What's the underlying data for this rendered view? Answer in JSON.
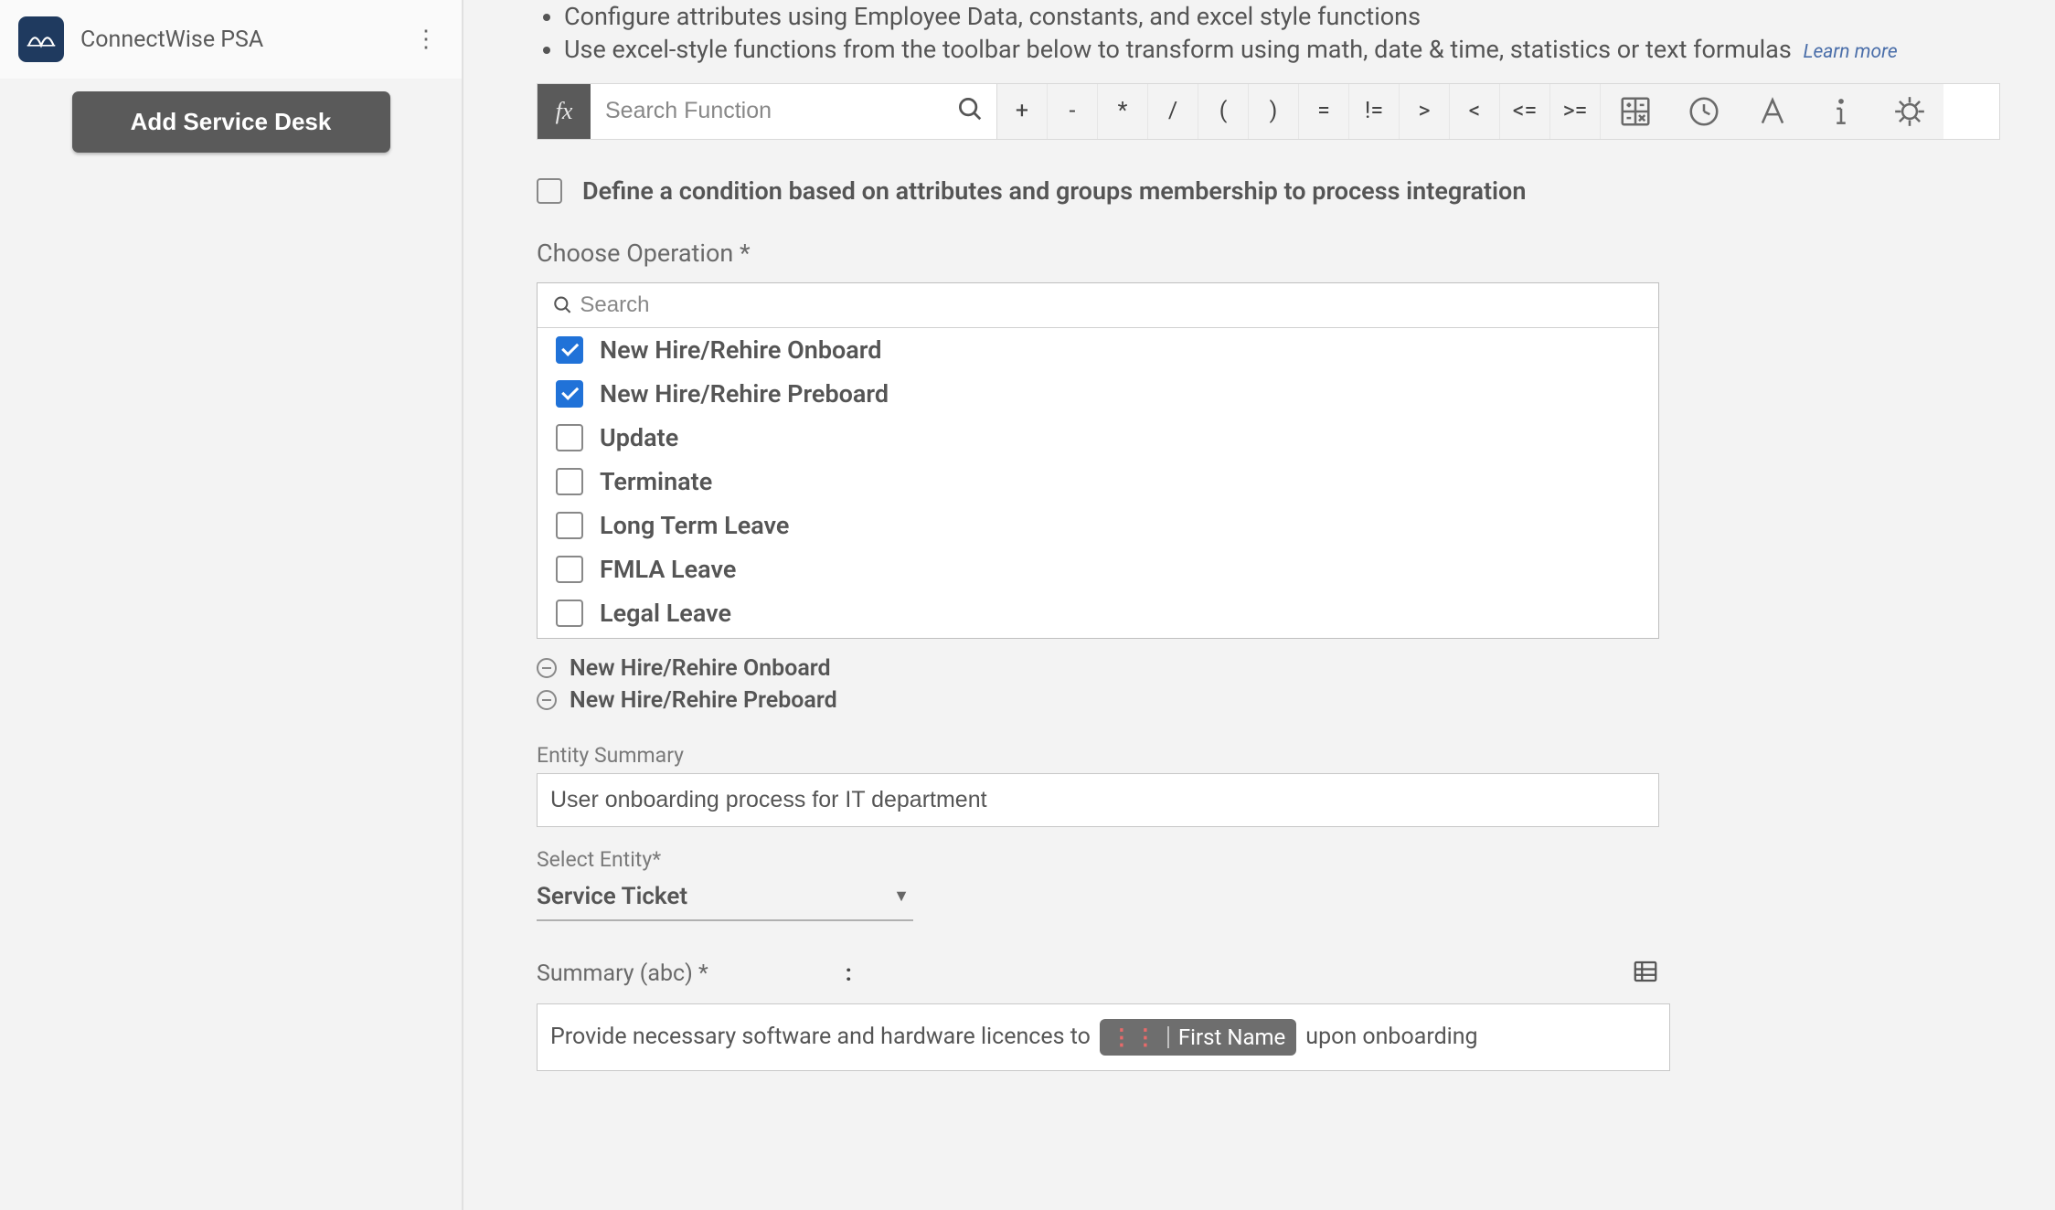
{
  "sidebar": {
    "app_label": "ConnectWise PSA",
    "add_button_label": "Add Service Desk"
  },
  "instructions": {
    "line1": "Configure attributes using Employee Data, constants, and excel style functions",
    "line2": "Use excel-style functions from the toolbar below to transform using math, date & time, statistics or text formulas",
    "learn_more": "Learn more"
  },
  "formula_bar": {
    "fx_label": "fx",
    "search_placeholder": "Search Function",
    "ops": [
      "+",
      "-",
      "*",
      "/",
      "(",
      ")",
      "=",
      "!=",
      ">",
      "<",
      "<=",
      ">="
    ]
  },
  "condition": {
    "text": "Define a condition based on attributes and groups membership to process integration",
    "checked": false
  },
  "choose_op": {
    "label": "Choose Operation *",
    "search_placeholder": "Search",
    "items": [
      {
        "label": "New Hire/Rehire Onboard",
        "checked": true
      },
      {
        "label": "New Hire/Rehire Preboard",
        "checked": true
      },
      {
        "label": "Update",
        "checked": false
      },
      {
        "label": "Terminate",
        "checked": false
      },
      {
        "label": "Long Term Leave",
        "checked": false
      },
      {
        "label": "FMLA Leave",
        "checked": false
      },
      {
        "label": "Legal Leave",
        "checked": false
      }
    ],
    "selected": [
      "New Hire/Rehire Onboard",
      "New Hire/Rehire Preboard"
    ]
  },
  "entity_summary": {
    "label": "Entity Summary",
    "value": "User onboarding process for IT department"
  },
  "select_entity": {
    "label": "Select Entity*",
    "value": "Service Ticket"
  },
  "summary_field": {
    "label": "Summary (abc) *",
    "colon": ":",
    "text_before": "Provide necessary software and hardware licences to",
    "chip_label": "First Name",
    "text_after": "upon onboarding"
  }
}
